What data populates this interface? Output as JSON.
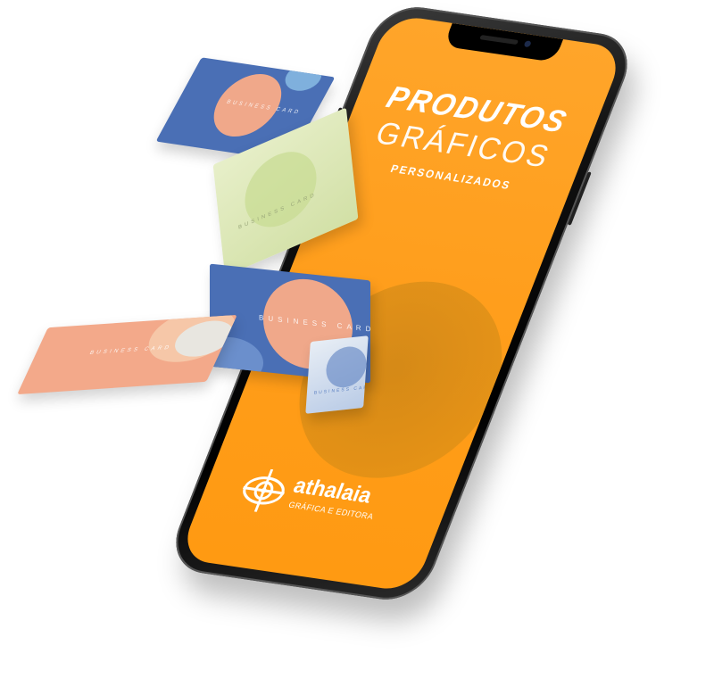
{
  "screen": {
    "title_line1": "PRODUTOS",
    "title_line2": "GRÁFICOS",
    "title_line3": "PERSONALIZADOS"
  },
  "logo": {
    "name": "athalaia",
    "subtitle": "GRÁFICA E EDITORA"
  },
  "cards": [
    {
      "label": "BUSINESS CARD",
      "theme": "blue"
    },
    {
      "label": "BUSINESS CARD",
      "theme": "green"
    },
    {
      "label": "BUSINESS CARD",
      "theme": "blue"
    },
    {
      "label": "BUSINESS CARD",
      "theme": "peach"
    },
    {
      "label": "BUSINESS CARD",
      "theme": "light-blue"
    }
  ],
  "colors": {
    "screen_orange": "#ffa01f",
    "card_blue": "#4a6fb5",
    "card_peach": "#f3a98a",
    "card_green": "#dbe6b5",
    "phone_black": "#111111"
  }
}
